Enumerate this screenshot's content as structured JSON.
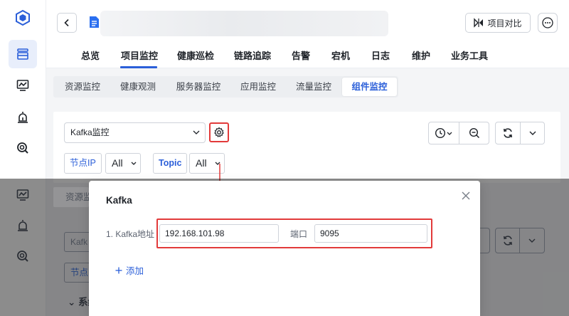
{
  "rail": {
    "icons": [
      "app-logo-icon",
      "project-icon",
      "chart-icon",
      "alarm-icon",
      "tools-icon"
    ]
  },
  "header": {
    "compare_label": "项目对比",
    "tabs": [
      {
        "label": "总览"
      },
      {
        "label": "项目监控"
      },
      {
        "label": "健康巡检"
      },
      {
        "label": "链路追踪"
      },
      {
        "label": "告警"
      },
      {
        "label": "宕机"
      },
      {
        "label": "日志"
      },
      {
        "label": "维护"
      },
      {
        "label": "业务工具"
      }
    ]
  },
  "subtabs": [
    {
      "label": "资源监控"
    },
    {
      "label": "健康观测"
    },
    {
      "label": "服务器监控"
    },
    {
      "label": "应用监控"
    },
    {
      "label": "流量监控"
    },
    {
      "label": "组件监控"
    }
  ],
  "panel": {
    "monitor_select_value": "Kafka监控",
    "node_ip_label": "节点IP",
    "node_ip_value": "All",
    "topic_label": "Topic",
    "topic_value": "All"
  },
  "background_fragments": {
    "subtab_fragment": "资源监",
    "select_fragment": "Kafk",
    "tag_fragment": "节点",
    "section_fragment": "系统"
  },
  "modal": {
    "title": "Kafka",
    "address_label": "1. Kafka地址",
    "address_value": "192.168.101.98",
    "port_label": "端口",
    "port_value": "9095",
    "add_label": "添加"
  },
  "colors": {
    "accent": "#2b5fd9",
    "highlight": "#e23a3a"
  }
}
